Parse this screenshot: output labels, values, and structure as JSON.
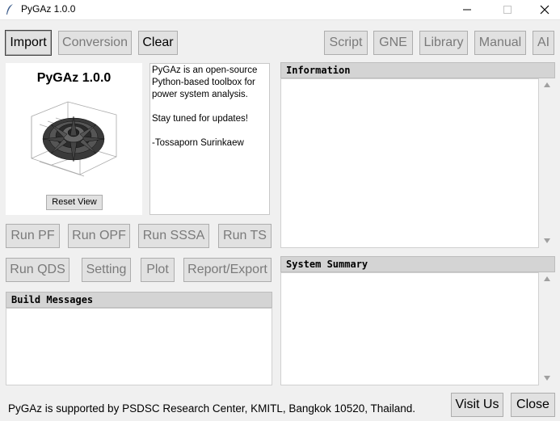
{
  "window": {
    "title": "PyGAz 1.0.0"
  },
  "top_toolbar": {
    "import": "Import",
    "conversion": "Conversion",
    "clear": "Clear",
    "script": "Script",
    "gne": "GNE",
    "library": "Library",
    "manual": "Manual",
    "ai": "AI"
  },
  "logo": {
    "title": "PyGAz 1.0.0",
    "reset_view": "Reset View"
  },
  "intro": {
    "line1": "PyGAz is an open-source Python-based toolbox for power system analysis.",
    "line2": "Stay tuned for updates!",
    "line3": "-Tossaporn Surinkaew"
  },
  "run_buttons": {
    "run_pf": "Run PF",
    "run_opf": "Run OPF",
    "run_sssa": "Run SSSA",
    "run_ts": "Run TS",
    "run_qds": "Run QDS",
    "setting": "Setting",
    "plot": "Plot",
    "report_export": "Report/Export"
  },
  "panels": {
    "build_messages": "Build Messages",
    "information": "Information",
    "system_summary": "System Summary"
  },
  "footer": {
    "support_text": "PyGAz is supported by PSDSC Research Center, KMITL, Bangkok 10520, Thailand.",
    "visit_us": "Visit Us",
    "close": "Close"
  }
}
